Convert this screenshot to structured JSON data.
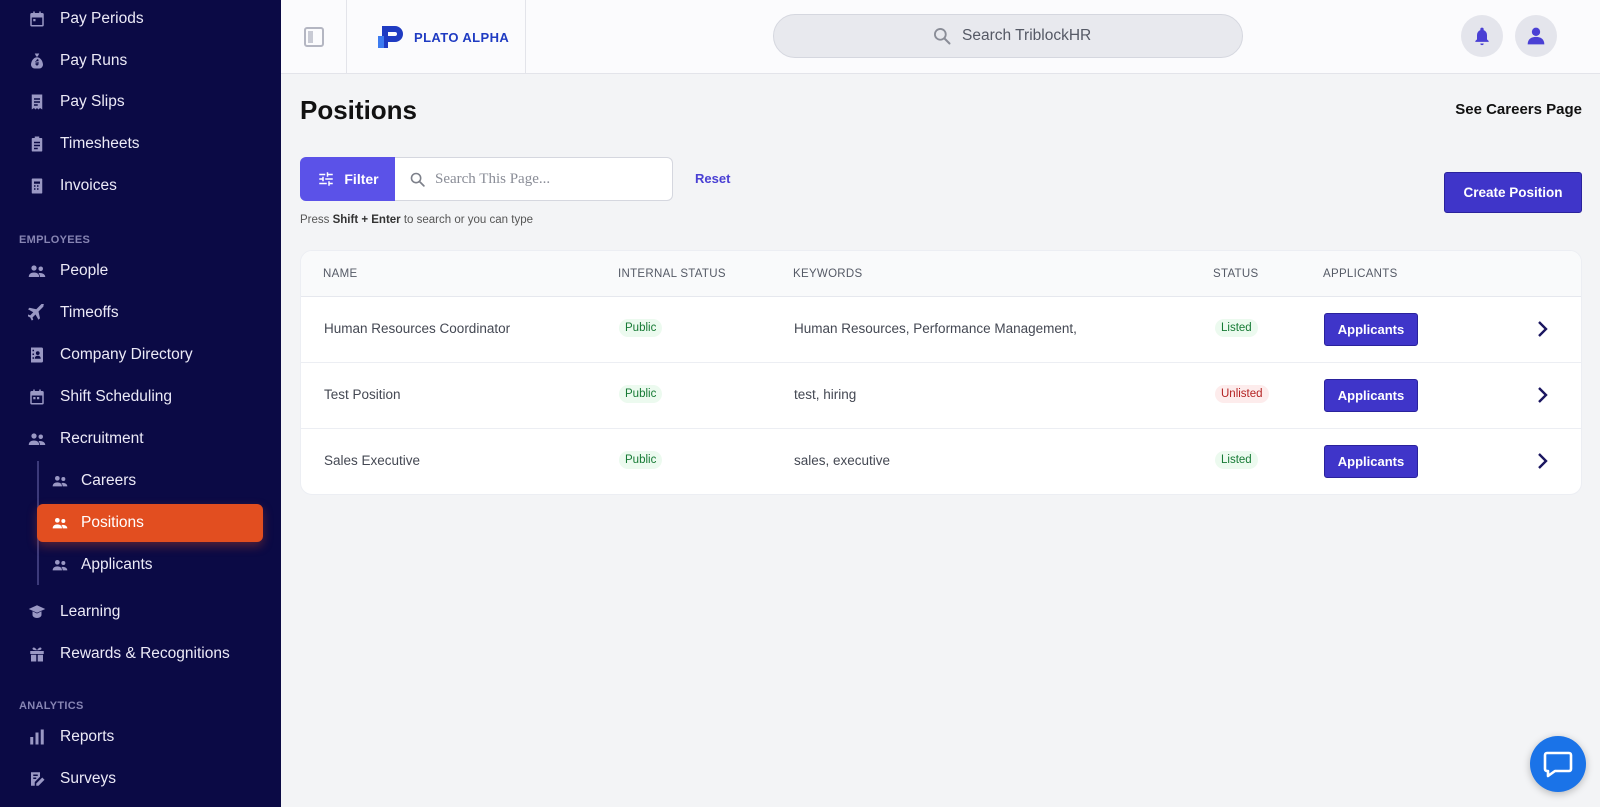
{
  "sidebar": {
    "top_items": [
      {
        "label": "Pay Periods",
        "icon": "calendar-icon"
      },
      {
        "label": "Pay Runs",
        "icon": "money-bag-icon"
      },
      {
        "label": "Pay Slips",
        "icon": "receipt-icon"
      },
      {
        "label": "Timesheets",
        "icon": "clipboard-icon"
      },
      {
        "label": "Invoices",
        "icon": "invoice-icon"
      }
    ],
    "employees_section": "EMPLOYEES",
    "employee_items": [
      {
        "label": "People",
        "icon": "users-icon"
      },
      {
        "label": "Timeoffs",
        "icon": "plane-icon"
      },
      {
        "label": "Company Directory",
        "icon": "directory-icon"
      },
      {
        "label": "Shift Scheduling",
        "icon": "calendar-icon"
      },
      {
        "label": "Recruitment",
        "icon": "users-icon"
      }
    ],
    "recruitment_sub": [
      {
        "label": "Careers",
        "icon": "users-icon"
      },
      {
        "label": "Positions",
        "icon": "users-icon",
        "active": true
      },
      {
        "label": "Applicants",
        "icon": "users-icon"
      }
    ],
    "more_items": [
      {
        "label": "Learning",
        "icon": "graduation-cap-icon"
      },
      {
        "label": "Rewards & Recognitions",
        "icon": "gift-icon"
      }
    ],
    "analytics_section": "ANALYTICS",
    "analytics_items": [
      {
        "label": "Reports",
        "icon": "bar-chart-icon"
      },
      {
        "label": "Surveys",
        "icon": "edit-note-icon"
      }
    ]
  },
  "topbar": {
    "logo_text": "PLATO ALPHA",
    "search_placeholder": "Search TriblockHR"
  },
  "main": {
    "title": "Positions",
    "careers_link": "See Careers Page",
    "filter_label": "Filter",
    "search_placeholder": "Search This Page...",
    "reset_label": "Reset",
    "hint_prefix": "Press ",
    "hint_keys": "Shift + Enter",
    "hint_suffix": " to search or you can type",
    "create_label": "Create Position"
  },
  "table": {
    "headers": [
      "NAME",
      "INTERNAL STATUS",
      "KEYWORDS",
      "STATUS",
      "APPLICANTS"
    ],
    "rows": [
      {
        "name": "Human Resources Coordinator",
        "internal_status": "Public",
        "keywords": "Human Resources, Performance Management,",
        "status": "Listed",
        "applicants_label": "Applicants"
      },
      {
        "name": "Test Position",
        "internal_status": "Public",
        "keywords": "test, hiring",
        "status": "Unlisted",
        "applicants_label": "Applicants"
      },
      {
        "name": "Sales Executive",
        "internal_status": "Public",
        "keywords": "sales, executive",
        "status": "Listed",
        "applicants_label": "Applicants"
      }
    ]
  },
  "colors": {
    "sidebar_bg": "#0b0a45",
    "active_item": "#e24e20",
    "primary": "#3f35c9",
    "filter": "#5b52e8"
  }
}
